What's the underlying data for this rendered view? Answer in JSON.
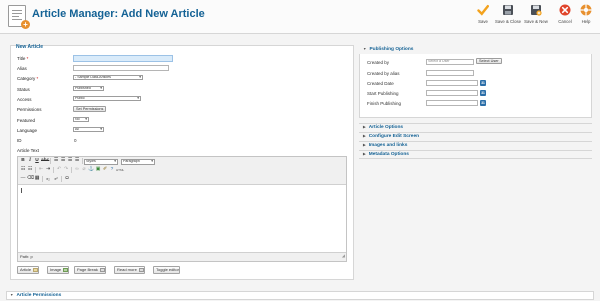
{
  "header": {
    "title": "Article Manager: Add New Article"
  },
  "toolbar": {
    "buttons": [
      {
        "label": "Save"
      },
      {
        "label": "Save & Close"
      },
      {
        "label": "Save & New"
      },
      {
        "label": "Cancel"
      },
      {
        "label": "Help"
      }
    ]
  },
  "form": {
    "legend": "New Article",
    "title_label": "Title",
    "alias_label": "Alias",
    "category_label": "Category",
    "category_value": "- Sample Data-Articles",
    "status_label": "Status",
    "status_value": "Published",
    "access_label": "Access",
    "access_value": "Public",
    "permissions_label": "Permissions",
    "permissions_button": "Set Permissions",
    "featured_label": "Featured",
    "featured_value": "No",
    "language_label": "Language",
    "language_value": "All",
    "id_label": "ID",
    "id_value": "0",
    "article_text_label": "Article Text",
    "required_mark": "*"
  },
  "editor": {
    "styles_value": "Styles",
    "paragraph_value": "Paragraph",
    "path_label": "Path: p",
    "buttons": [
      {
        "label": "Article"
      },
      {
        "label": "Image"
      },
      {
        "label": "Page Break"
      },
      {
        "label": "Read more"
      },
      {
        "label": "Toggle editor"
      }
    ]
  },
  "publishing": {
    "title": "Publishing Options",
    "created_by_label": "Created by",
    "created_by_placeholder": "Select a User",
    "select_user_button": "Select User",
    "created_by_alias_label": "Created by alias",
    "created_date_label": "Created Date",
    "start_publishing_label": "Start Publishing",
    "finish_publishing_label": "Finish Publishing"
  },
  "accordion": {
    "items": [
      {
        "label": "Article Options"
      },
      {
        "label": "Configure Edit Screen"
      },
      {
        "label": "Images and links"
      },
      {
        "label": "Metadata Options"
      }
    ]
  },
  "permissions_section": {
    "title": "Article Permissions"
  },
  "colors": {
    "brand": "#146295",
    "save": "#f3a21d",
    "cancel": "#e0452c"
  }
}
